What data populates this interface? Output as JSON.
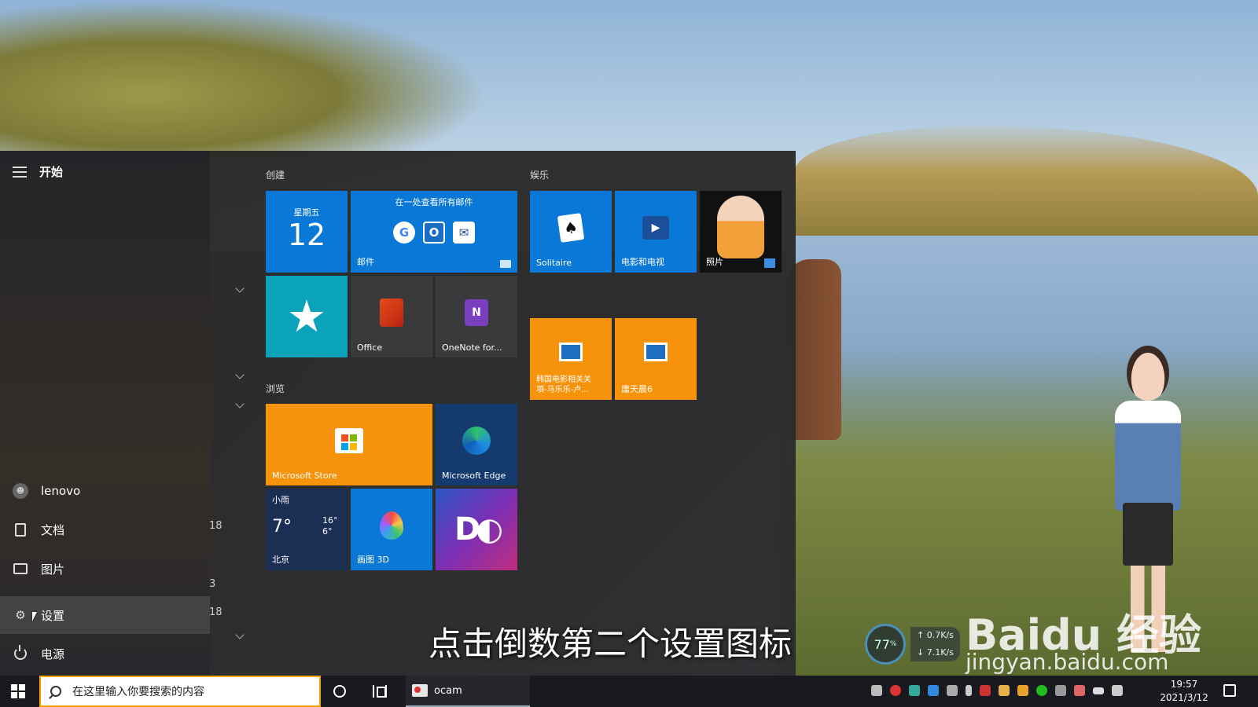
{
  "start_menu": {
    "title": "开始",
    "rail_items": [
      {
        "label": "lenovo",
        "icon": "user-avatar-icon"
      },
      {
        "label": "文档",
        "icon": "document-icon"
      },
      {
        "label": "图片",
        "icon": "pictures-icon"
      },
      {
        "label": "设置",
        "icon": "gear-icon"
      },
      {
        "label": "电源",
        "icon": "power-icon"
      }
    ],
    "list_fragments": [
      "18",
      "3",
      "18"
    ],
    "groups": {
      "create": "创建",
      "entertainment": "娱乐",
      "browse": "浏览"
    },
    "tiles": {
      "calendar": {
        "weekday": "星期五",
        "day": "12"
      },
      "mail": {
        "top_text": "在一处查看所有邮件",
        "label": "邮件"
      },
      "solitaire": {
        "label": "Solitaire"
      },
      "movies": {
        "label": "电影和电视"
      },
      "photos": {
        "label": "照片"
      },
      "office": {
        "label": "Office"
      },
      "onenote": {
        "label": "OneNote for..."
      },
      "korean_movie": {
        "label": "韩国电影相关关\n項-马乐乐-卢..."
      },
      "app6": {
        "label": "庸天晨6"
      },
      "store": {
        "label": "Microsoft Store"
      },
      "edge": {
        "label": "Microsoft Edge"
      },
      "weather": {
        "condition": "小雨",
        "temp": "7°",
        "high": "16°",
        "low": "6°",
        "city": "北京"
      },
      "paint3d": {
        "label": "画图 3D"
      }
    }
  },
  "caption": "点击倒数第二个设置图标",
  "net_monitor": {
    "percent": "77",
    "percent_unit": "%",
    "up": "0.7K/s",
    "down": "7.1K/s"
  },
  "watermark": {
    "brand": "Baidu 经验",
    "url": "jingyan.baidu.com"
  },
  "taskbar": {
    "search_placeholder": "在这里输入你要搜索的内容",
    "open_app": "ocam",
    "time": "19:57",
    "date": "2021/3/12"
  },
  "colors": {
    "accent_blue": "#0a78d7",
    "tile_orange": "#f7930a",
    "search_border": "#f7a300"
  }
}
